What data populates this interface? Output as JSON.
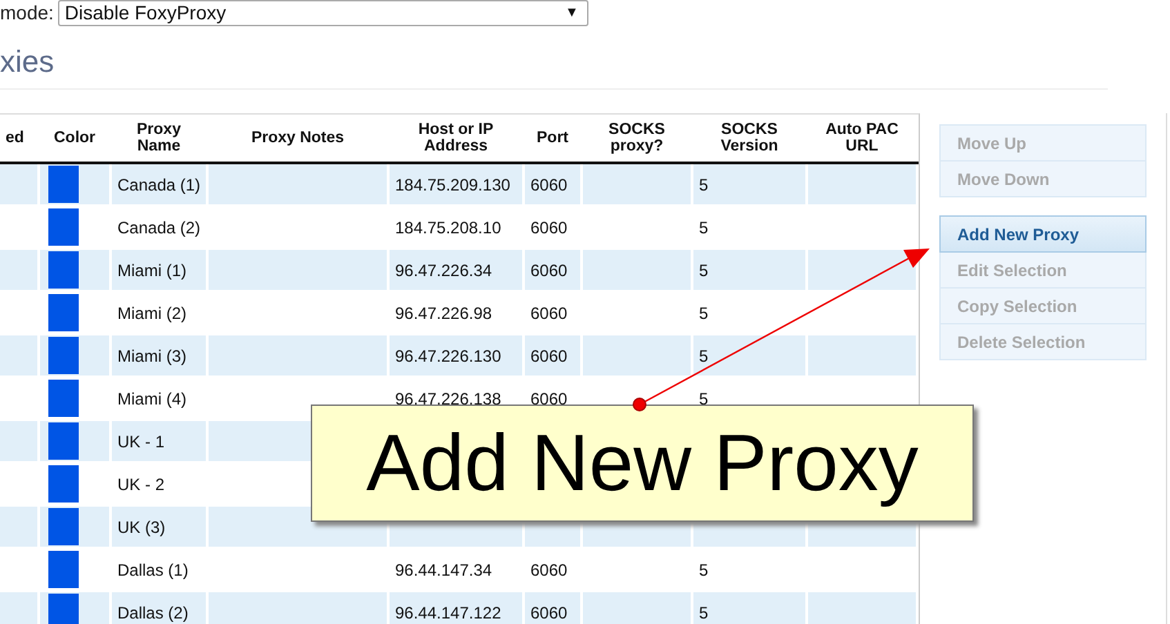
{
  "mode_selector": {
    "label": "mode:",
    "value": "Disable FoxyProxy",
    "caret": "▼"
  },
  "heading": "xies",
  "table": {
    "columns": [
      "ed",
      "Color",
      "Proxy Name",
      "Proxy Notes",
      "Host or IP Address",
      "Port",
      "SOCKS proxy?",
      "SOCKS Version",
      "Auto PAC URL"
    ],
    "rows": [
      {
        "name": "Canada (1)",
        "host": "184.75.209.130",
        "port": "6060",
        "socks_version": "5",
        "color": "#0055e5"
      },
      {
        "name": "Canada (2)",
        "host": "184.75.208.10",
        "port": "6060",
        "socks_version": "5",
        "color": "#0055e5"
      },
      {
        "name": "Miami (1)",
        "host": "96.47.226.34",
        "port": "6060",
        "socks_version": "5",
        "color": "#0055e5"
      },
      {
        "name": "Miami (2)",
        "host": "96.47.226.98",
        "port": "6060",
        "socks_version": "5",
        "color": "#0055e5"
      },
      {
        "name": "Miami (3)",
        "host": "96.47.226.130",
        "port": "6060",
        "socks_version": "5",
        "color": "#0055e5"
      },
      {
        "name": "Miami (4)",
        "host": "96.47.226.138",
        "port": "6060",
        "socks_version": "5",
        "color": "#0055e5"
      },
      {
        "name": "UK - 1",
        "color": "#0055e5"
      },
      {
        "name": "UK - 2",
        "color": "#0055e5"
      },
      {
        "name": "UK (3)",
        "color": "#0055e5"
      },
      {
        "name": "Dallas (1)",
        "host": "96.44.147.34",
        "port": "6060",
        "socks_version": "5",
        "color": "#0055e5"
      },
      {
        "name": "Dallas (2)",
        "host": "96.44.147.122",
        "port": "6060",
        "socks_version": "5",
        "color": "#0055e5"
      }
    ]
  },
  "button_groups": [
    [
      {
        "label": "Move Up",
        "disabled": true,
        "highlighted": false
      },
      {
        "label": "Move Down",
        "disabled": true,
        "highlighted": false
      }
    ],
    [
      {
        "label": "Add New Proxy",
        "disabled": false,
        "highlighted": true
      },
      {
        "label": "Edit Selection",
        "disabled": true,
        "highlighted": false
      },
      {
        "label": "Copy Selection",
        "disabled": true,
        "highlighted": false
      },
      {
        "label": "Delete Selection",
        "disabled": true,
        "highlighted": false
      }
    ]
  ],
  "callout": {
    "text": "Add New Proxy"
  }
}
